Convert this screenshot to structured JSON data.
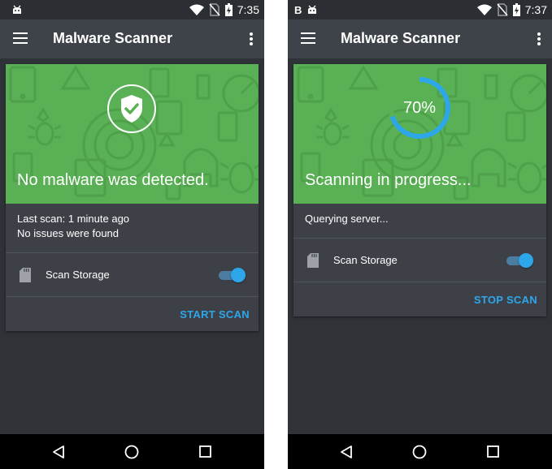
{
  "colors": {
    "hero_green": "#5ab155",
    "accent_blue": "#2ea6ea",
    "app_bar": "#3e4349",
    "background": "#2f3338",
    "card": "#3d4147"
  },
  "screens": [
    {
      "status_bar": {
        "letter": "",
        "time": "7:35",
        "icons": [
          "android-debug-icon",
          "wifi-icon",
          "no-sim-icon",
          "battery-charging-icon"
        ]
      },
      "app_bar": {
        "title": "Malware Scanner",
        "menu_icon": "hamburger-menu-icon",
        "overflow_icon": "more-vert-icon"
      },
      "hero": {
        "icon": "shield-check-icon",
        "headline": "No malware was detected."
      },
      "info": {
        "line1": "Last scan: 1 minute ago",
        "line2": "No issues were found"
      },
      "storage": {
        "icon": "sd-card-icon",
        "label": "Scan Storage",
        "enabled": true
      },
      "action": {
        "label": "START SCAN"
      },
      "nav": [
        "back-icon",
        "home-icon",
        "recents-icon"
      ]
    },
    {
      "status_bar": {
        "letter": "B",
        "time": "7:37",
        "icons": [
          "android-debug-icon",
          "wifi-icon",
          "no-sim-icon",
          "battery-charging-icon"
        ]
      },
      "app_bar": {
        "title": "Malware Scanner",
        "menu_icon": "hamburger-menu-icon",
        "overflow_icon": "more-vert-icon"
      },
      "hero": {
        "progress": 0.7,
        "progress_label": "70%",
        "headline": "Scanning in progress..."
      },
      "info": {
        "line1": "Querying server..."
      },
      "storage": {
        "icon": "sd-card-icon",
        "label": "Scan Storage",
        "enabled": true
      },
      "action": {
        "label": "STOP SCAN"
      },
      "nav": [
        "back-icon",
        "home-icon",
        "recents-icon"
      ]
    }
  ]
}
